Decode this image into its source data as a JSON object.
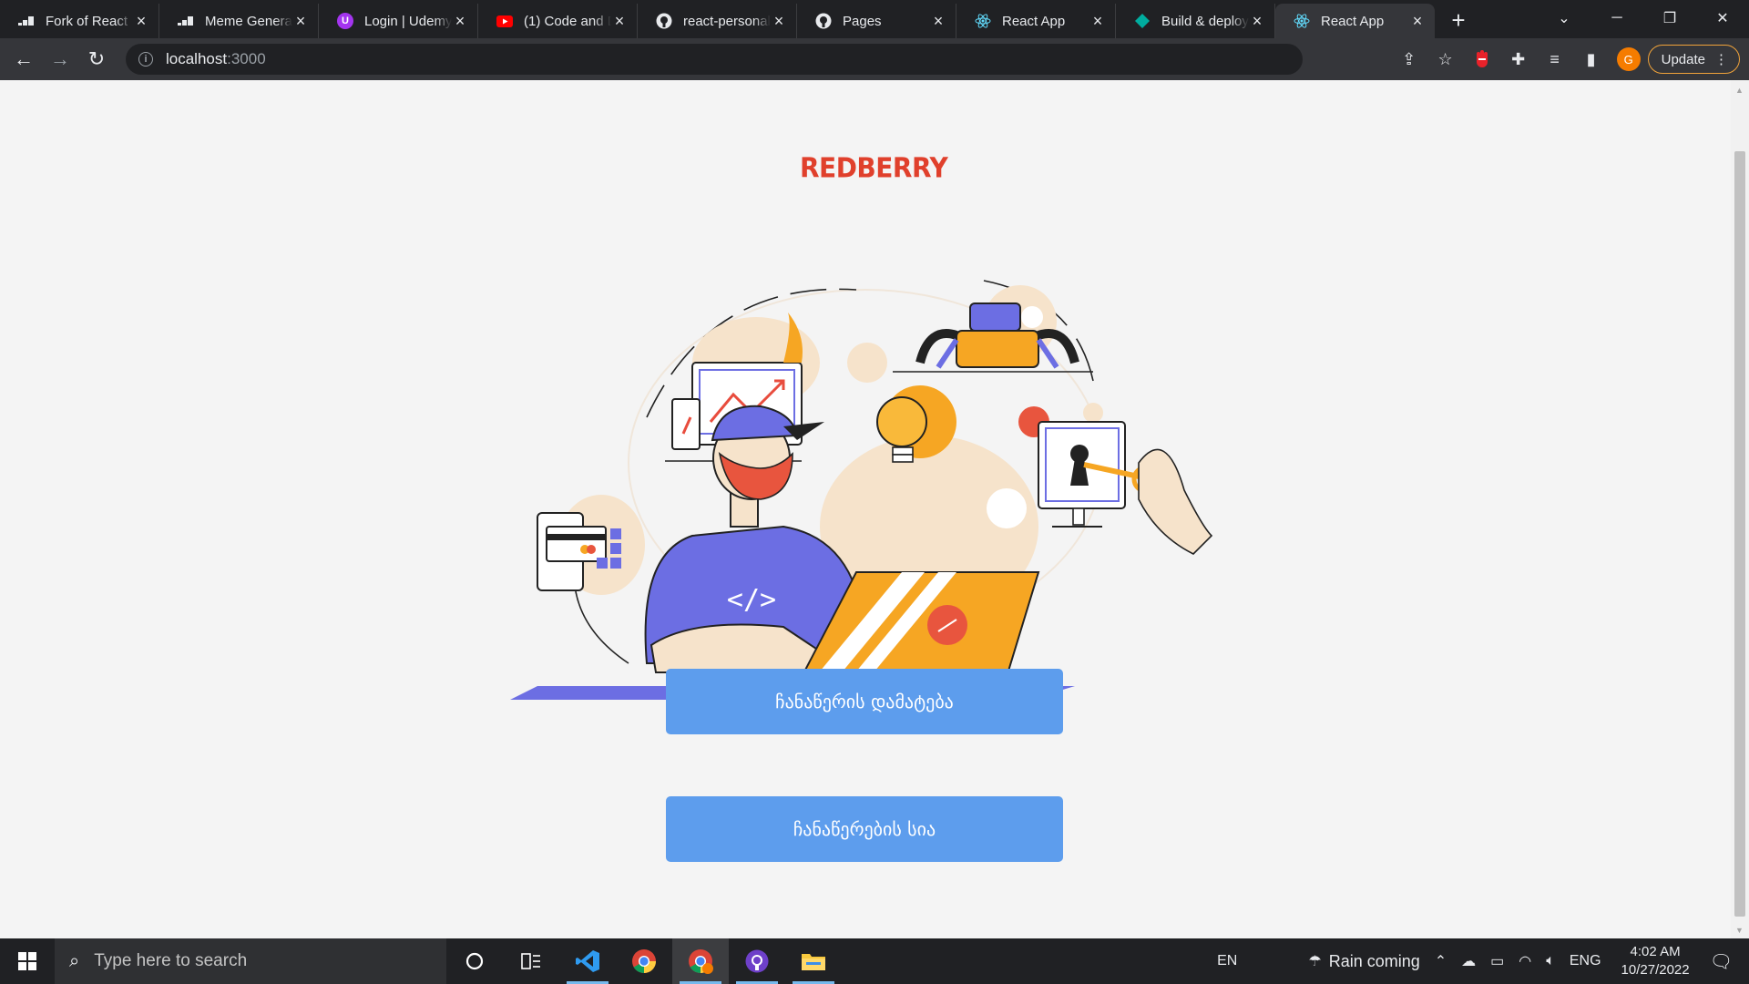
{
  "browser": {
    "tabs": [
      {
        "title": "Fork of React",
        "icon": "codepen-icon",
        "active": false
      },
      {
        "title": "Meme Generator",
        "icon": "codepen-icon",
        "active": false
      },
      {
        "title": "Login | Udemy",
        "icon": "udemy-icon",
        "active": false
      },
      {
        "title": "(1) Code and D",
        "icon": "youtube-icon",
        "active": false
      },
      {
        "title": "react-personal",
        "icon": "github-icon",
        "active": false
      },
      {
        "title": "Pages",
        "icon": "github-icon",
        "active": false
      },
      {
        "title": "React App",
        "icon": "react-icon",
        "active": false
      },
      {
        "title": "Build & deploy",
        "icon": "diamond-icon",
        "active": false
      },
      {
        "title": "React App",
        "icon": "react-icon",
        "active": true
      }
    ],
    "address": {
      "host": "localhost",
      "port": ":3000"
    },
    "update_label": "Update",
    "avatar_letter": "G"
  },
  "page": {
    "logo_text": "REDBERRY",
    "buttons": {
      "add_record": "ჩანაწერის დამატება",
      "records_list": "ჩანაწერების სია"
    }
  },
  "taskbar": {
    "search_placeholder": "Type here to search",
    "lang_indicator": "EN",
    "weather": "Rain coming",
    "keyboard": "ENG",
    "time": "4:02 AM",
    "date": "10/27/2022"
  },
  "colors": {
    "brand_red": "#e0402c",
    "button_blue": "#5d9ded",
    "page_bg": "#f4f4f4"
  }
}
